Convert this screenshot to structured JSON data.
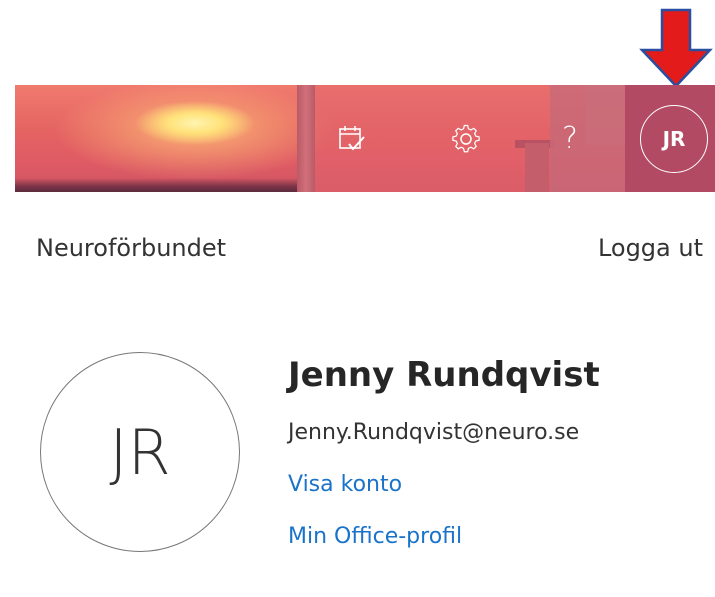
{
  "header": {
    "icons": {
      "calendar": "calendar-check-icon",
      "settings": "gear-icon",
      "help": "question-mark-icon"
    },
    "help_label": "?",
    "avatar_initials": "JR"
  },
  "account_panel": {
    "organization": "Neuroförbundet",
    "logout_label": "Logga ut",
    "avatar_initials": "JR",
    "user_name": "Jenny Rundqvist",
    "email": "Jenny.Rundqvist@neuro.se",
    "view_account_label": "Visa konto",
    "office_profile_label": "Min Office-profil"
  },
  "annotation": {
    "arrow_color": "#e31b1b",
    "arrow_outline": "#2a4fa0"
  },
  "colors": {
    "link": "#1a73c9",
    "text": "#333333"
  }
}
